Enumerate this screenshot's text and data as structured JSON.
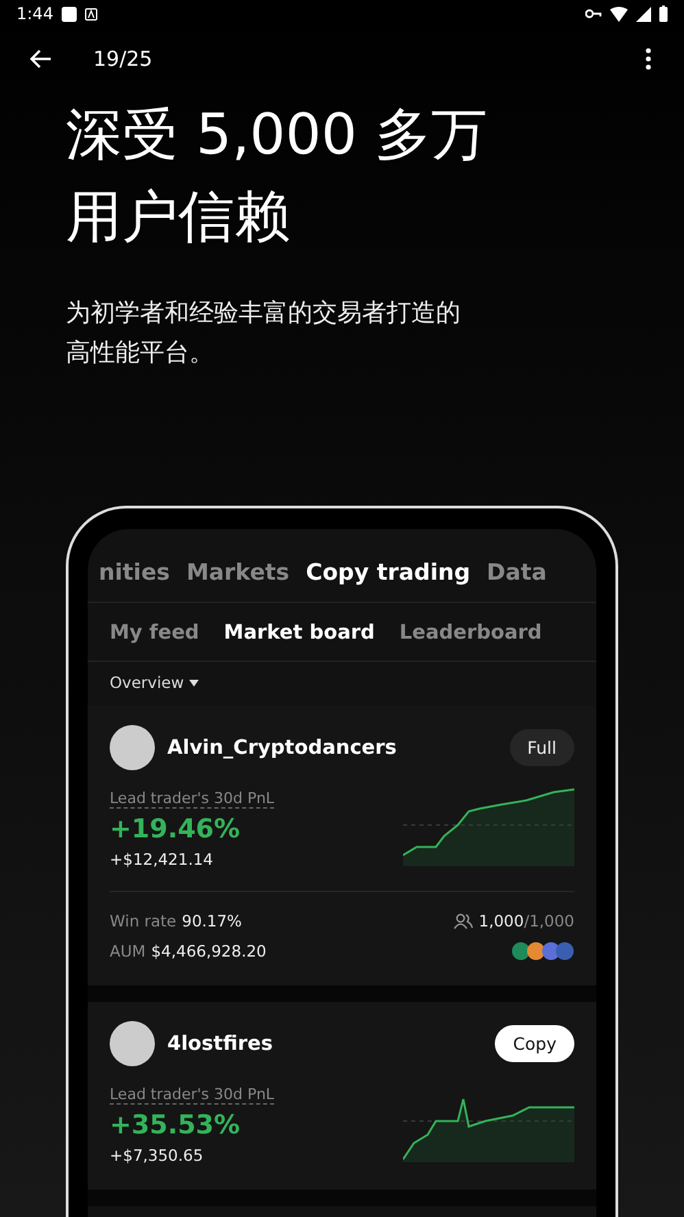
{
  "status_bar": {
    "time": "1:44"
  },
  "app_bar": {
    "counter": "19/25"
  },
  "headline": [
    "深受 5,000 多万",
    "用户信赖"
  ],
  "subtitle": [
    "为初学者和经验丰富的交易者打造的",
    "高性能平台。"
  ],
  "phone": {
    "top_tabs": [
      {
        "label": "nities",
        "selected": false
      },
      {
        "label": "Markets",
        "selected": false
      },
      {
        "label": "Copy trading",
        "selected": true
      },
      {
        "label": "Data",
        "selected": false
      }
    ],
    "sub_tabs": [
      {
        "label": "My feed",
        "selected": false
      },
      {
        "label": "Market board",
        "selected": true
      },
      {
        "label": "Leaderboard",
        "selected": false
      }
    ],
    "filter": "Overview",
    "traders": [
      {
        "name": "Alvin_Cryptodancers",
        "button": {
          "label": "Full",
          "kind": "full"
        },
        "pnl_label": "Lead trader's 30d PnL",
        "pnl_percent": "+19.46%",
        "pnl_amount": "+$12,421.14",
        "stats": {
          "win_rate_label": "Win rate",
          "win_rate": "90.17%",
          "aum_label": "AUM",
          "aum": "$4,466,928.20",
          "copiers": "1,000",
          "copiers_max": "/1,000"
        }
      },
      {
        "name": "4lostfires",
        "button": {
          "label": "Copy",
          "kind": "copy"
        },
        "pnl_label": "Lead trader's 30d PnL",
        "pnl_percent": "+35.53%",
        "pnl_amount": "+$7,350.65"
      }
    ]
  }
}
